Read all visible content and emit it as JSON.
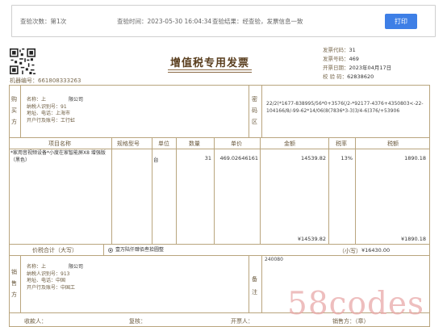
{
  "topbar": {
    "check_count": "查验次数：第1次",
    "check_time": "查验时间：2023-05-30 16:04:34",
    "check_result": "查验结果：经查验，发票信息一致",
    "print_label": "打印"
  },
  "invoice": {
    "title": "增值税专用发票",
    "machine_no": "机器编号：661808333263",
    "code_label": "发票代码：",
    "code_value": "31",
    "number_label": "发票号码：",
    "number_value": "469",
    "date_label": "开票日期：",
    "date_value": "2023年04月17日",
    "check_code_label": "校  验  码：",
    "check_code_value": "62838620"
  },
  "buyer": {
    "side_label": [
      "购",
      "买",
      "方"
    ],
    "name": "名称：上",
    "name_tail": "限公司",
    "tax_id": "纳税人识别号：91",
    "address": "地址、电话：上海市",
    "bank": "开户行及账号：工行虹"
  },
  "password_area": {
    "side_label": [
      "密",
      "码",
      "区"
    ],
    "text": "22/2(*1677-838995/56*0+3576(/2-*92177-4376+4350803<-22-104166/8/-99-62*14/06(8(7836*3-3)3/4-6)376/+53906"
  },
  "items": {
    "headers": [
      "项目名称",
      "规格型号",
      "单位",
      "数量",
      "单价",
      "金额",
      "税率",
      "税额"
    ],
    "rows": [
      {
        "name": "*家用音视频设备*小度在家智能屏X8 增强版（黑色）",
        "spec": "",
        "unit": "台",
        "qty": "31",
        "price": "469.02646161",
        "amount": "14539.82",
        "rate": "13%",
        "tax": "1890.18"
      }
    ],
    "total_amount": "¥14539.82",
    "total_tax": "¥1890.18"
  },
  "grand_total": {
    "label": "价税合计（大写）",
    "chinese": "壹万陆仟肆佰叁拾圆整",
    "small_label": "（小写）",
    "small_value": "¥16430.00"
  },
  "seller": {
    "side_label": [
      "销",
      "售",
      "方"
    ],
    "name": "名称：上",
    "name_tail": "限公司",
    "tax_id": "纳税人识别号：913",
    "address": "地址、电话：中国",
    "bank": "开户行及账号：中国工"
  },
  "remark": {
    "side_label": [
      "备",
      "注"
    ],
    "text": "240080"
  },
  "footer": {
    "payee": "收款人：",
    "reviewer": "复核：",
    "drawer": "开票人：",
    "seller_stamp": "销售方：（章）"
  },
  "watermark": "58codes"
}
